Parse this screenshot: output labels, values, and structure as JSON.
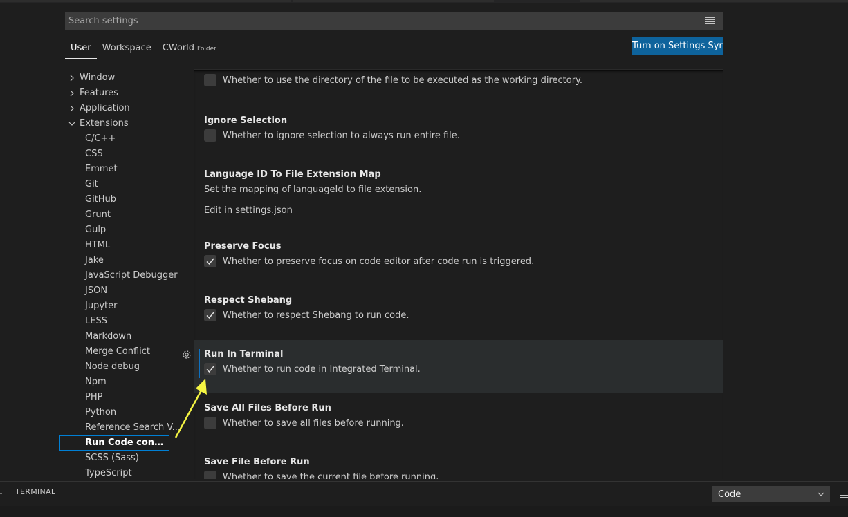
{
  "search": {
    "placeholder": "Search settings"
  },
  "tabs": [
    {
      "label": "User"
    },
    {
      "label": "Workspace"
    },
    {
      "label": "CWorld",
      "sub": "Folder"
    }
  ],
  "sync_button": "Turn on Settings Sync",
  "toc": {
    "groups": [
      "Window",
      "Features",
      "Application",
      "Extensions"
    ],
    "extensions": [
      "C/C++",
      "CSS",
      "Emmet",
      "Git",
      "GitHub",
      "Grunt",
      "Gulp",
      "HTML",
      "Jake",
      "JavaScript Debugger",
      "JSON",
      "Jupyter",
      "LESS",
      "Markdown",
      "Merge Conflict",
      "Node debug",
      "Npm",
      "PHP",
      "Python",
      "Reference Search V...",
      "Run Code configu...",
      "SCSS (Sass)",
      "TypeScript"
    ]
  },
  "settings": {
    "file_directory_desc": "Whether to use the directory of the file to be executed as the working directory.",
    "ignore_selection": {
      "title": "Ignore Selection",
      "desc": "Whether to ignore selection to always run entire file.",
      "checked": false
    },
    "language_map": {
      "title": "Language ID To File Extension Map",
      "desc": "Set the mapping of languageId to file extension.",
      "link": "Edit in settings.json"
    },
    "preserve_focus": {
      "title": "Preserve Focus",
      "desc": "Whether to preserve focus on code editor after code run is triggered.",
      "checked": true
    },
    "respect_shebang": {
      "title": "Respect Shebang",
      "desc": "Whether to respect Shebang to run code.",
      "checked": true
    },
    "run_in_terminal": {
      "title": "Run In Terminal",
      "desc": "Whether to run code in Integrated Terminal.",
      "checked": true
    },
    "save_all_files": {
      "title": "Save All Files Before Run",
      "desc": "Whether to save all files before running.",
      "checked": false
    },
    "save_file": {
      "title": "Save File Before Run",
      "desc": "Whether to save the current file before running.",
      "checked": false
    }
  },
  "panel": {
    "tab": "TERMINAL",
    "select_value": "Code"
  },
  "colors": {
    "accent": "#0e639c",
    "annotation_arrow": "#f5f543"
  }
}
